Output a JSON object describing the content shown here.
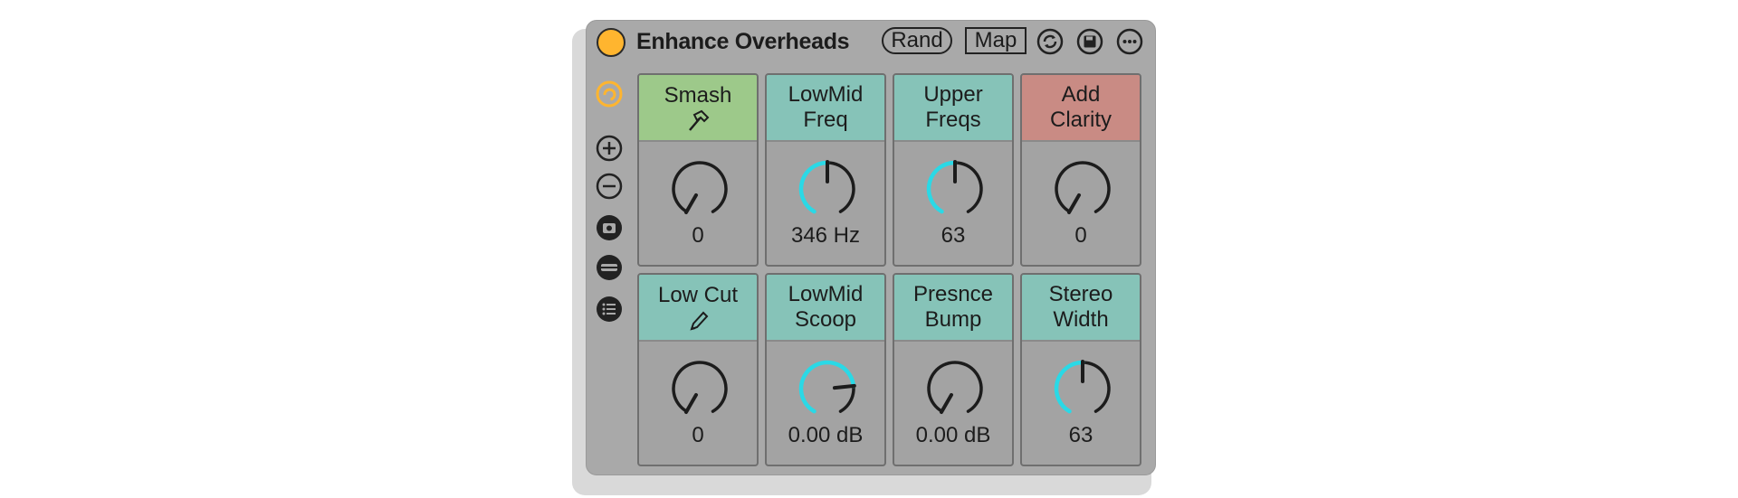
{
  "device": {
    "title": "Enhance Overheads",
    "rand_label": "Rand",
    "map_label": "Map",
    "colors": {
      "power": "#ffb52f",
      "accent": "#2ad9e6",
      "green": "#9dc98a",
      "teal": "#86c3b8",
      "red": "#c98b84"
    }
  },
  "sidebar": {
    "icons": [
      "hot-swap-icon",
      "add-variation-icon",
      "remove-variation-icon",
      "camera-icon",
      "macro-bar-icon",
      "list-icon"
    ]
  },
  "macros": [
    {
      "line1": "Smash",
      "line2": "",
      "sub_icon": "hammer-icon",
      "value": "0",
      "color": "green",
      "level": 0.0
    },
    {
      "line1": "LowMid",
      "line2": "Freq",
      "sub_icon": "",
      "value": "346 Hz",
      "color": "teal",
      "level": 0.5
    },
    {
      "line1": "Upper",
      "line2": "Freqs",
      "sub_icon": "",
      "value": "63",
      "color": "teal",
      "level": 0.5
    },
    {
      "line1": "Add",
      "line2": "Clarity",
      "sub_icon": "",
      "value": "0",
      "color": "red",
      "level": 0.0
    },
    {
      "line1": "Low Cut",
      "line2": "",
      "sub_icon": "pencil-icon",
      "value": "0",
      "color": "teal",
      "level": 0.0
    },
    {
      "line1": "LowMid",
      "line2": "Scoop",
      "sub_icon": "",
      "value": "0.00 dB",
      "color": "teal",
      "level": 0.78
    },
    {
      "line1": "Presnce",
      "line2": "Bump",
      "sub_icon": "",
      "value": "0.00 dB",
      "color": "teal",
      "level": 0.0
    },
    {
      "line1": "Stereo",
      "line2": "Width",
      "sub_icon": "",
      "value": "63",
      "color": "teal",
      "level": 0.5
    }
  ]
}
